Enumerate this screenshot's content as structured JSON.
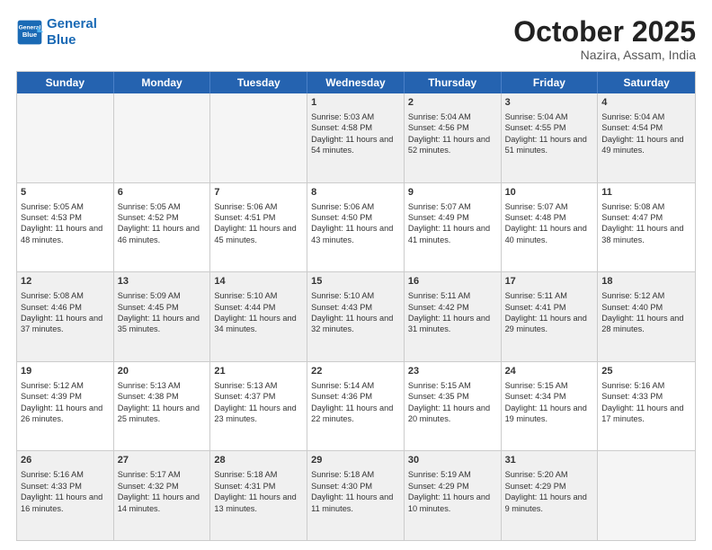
{
  "header": {
    "logo_line1": "General",
    "logo_line2": "Blue",
    "month": "October 2025",
    "location": "Nazira, Assam, India"
  },
  "weekdays": [
    "Sunday",
    "Monday",
    "Tuesday",
    "Wednesday",
    "Thursday",
    "Friday",
    "Saturday"
  ],
  "rows": [
    [
      {
        "day": "",
        "sunrise": "",
        "sunset": "",
        "daylight": "",
        "empty": true
      },
      {
        "day": "",
        "sunrise": "",
        "sunset": "",
        "daylight": "",
        "empty": true
      },
      {
        "day": "",
        "sunrise": "",
        "sunset": "",
        "daylight": "",
        "empty": true
      },
      {
        "day": "1",
        "sunrise": "Sunrise: 5:03 AM",
        "sunset": "Sunset: 4:58 PM",
        "daylight": "Daylight: 11 hours and 54 minutes."
      },
      {
        "day": "2",
        "sunrise": "Sunrise: 5:04 AM",
        "sunset": "Sunset: 4:56 PM",
        "daylight": "Daylight: 11 hours and 52 minutes."
      },
      {
        "day": "3",
        "sunrise": "Sunrise: 5:04 AM",
        "sunset": "Sunset: 4:55 PM",
        "daylight": "Daylight: 11 hours and 51 minutes."
      },
      {
        "day": "4",
        "sunrise": "Sunrise: 5:04 AM",
        "sunset": "Sunset: 4:54 PM",
        "daylight": "Daylight: 11 hours and 49 minutes."
      }
    ],
    [
      {
        "day": "5",
        "sunrise": "Sunrise: 5:05 AM",
        "sunset": "Sunset: 4:53 PM",
        "daylight": "Daylight: 11 hours and 48 minutes."
      },
      {
        "day": "6",
        "sunrise": "Sunrise: 5:05 AM",
        "sunset": "Sunset: 4:52 PM",
        "daylight": "Daylight: 11 hours and 46 minutes."
      },
      {
        "day": "7",
        "sunrise": "Sunrise: 5:06 AM",
        "sunset": "Sunset: 4:51 PM",
        "daylight": "Daylight: 11 hours and 45 minutes."
      },
      {
        "day": "8",
        "sunrise": "Sunrise: 5:06 AM",
        "sunset": "Sunset: 4:50 PM",
        "daylight": "Daylight: 11 hours and 43 minutes."
      },
      {
        "day": "9",
        "sunrise": "Sunrise: 5:07 AM",
        "sunset": "Sunset: 4:49 PM",
        "daylight": "Daylight: 11 hours and 41 minutes."
      },
      {
        "day": "10",
        "sunrise": "Sunrise: 5:07 AM",
        "sunset": "Sunset: 4:48 PM",
        "daylight": "Daylight: 11 hours and 40 minutes."
      },
      {
        "day": "11",
        "sunrise": "Sunrise: 5:08 AM",
        "sunset": "Sunset: 4:47 PM",
        "daylight": "Daylight: 11 hours and 38 minutes."
      }
    ],
    [
      {
        "day": "12",
        "sunrise": "Sunrise: 5:08 AM",
        "sunset": "Sunset: 4:46 PM",
        "daylight": "Daylight: 11 hours and 37 minutes."
      },
      {
        "day": "13",
        "sunrise": "Sunrise: 5:09 AM",
        "sunset": "Sunset: 4:45 PM",
        "daylight": "Daylight: 11 hours and 35 minutes."
      },
      {
        "day": "14",
        "sunrise": "Sunrise: 5:10 AM",
        "sunset": "Sunset: 4:44 PM",
        "daylight": "Daylight: 11 hours and 34 minutes."
      },
      {
        "day": "15",
        "sunrise": "Sunrise: 5:10 AM",
        "sunset": "Sunset: 4:43 PM",
        "daylight": "Daylight: 11 hours and 32 minutes."
      },
      {
        "day": "16",
        "sunrise": "Sunrise: 5:11 AM",
        "sunset": "Sunset: 4:42 PM",
        "daylight": "Daylight: 11 hours and 31 minutes."
      },
      {
        "day": "17",
        "sunrise": "Sunrise: 5:11 AM",
        "sunset": "Sunset: 4:41 PM",
        "daylight": "Daylight: 11 hours and 29 minutes."
      },
      {
        "day": "18",
        "sunrise": "Sunrise: 5:12 AM",
        "sunset": "Sunset: 4:40 PM",
        "daylight": "Daylight: 11 hours and 28 minutes."
      }
    ],
    [
      {
        "day": "19",
        "sunrise": "Sunrise: 5:12 AM",
        "sunset": "Sunset: 4:39 PM",
        "daylight": "Daylight: 11 hours and 26 minutes."
      },
      {
        "day": "20",
        "sunrise": "Sunrise: 5:13 AM",
        "sunset": "Sunset: 4:38 PM",
        "daylight": "Daylight: 11 hours and 25 minutes."
      },
      {
        "day": "21",
        "sunrise": "Sunrise: 5:13 AM",
        "sunset": "Sunset: 4:37 PM",
        "daylight": "Daylight: 11 hours and 23 minutes."
      },
      {
        "day": "22",
        "sunrise": "Sunrise: 5:14 AM",
        "sunset": "Sunset: 4:36 PM",
        "daylight": "Daylight: 11 hours and 22 minutes."
      },
      {
        "day": "23",
        "sunrise": "Sunrise: 5:15 AM",
        "sunset": "Sunset: 4:35 PM",
        "daylight": "Daylight: 11 hours and 20 minutes."
      },
      {
        "day": "24",
        "sunrise": "Sunrise: 5:15 AM",
        "sunset": "Sunset: 4:34 PM",
        "daylight": "Daylight: 11 hours and 19 minutes."
      },
      {
        "day": "25",
        "sunrise": "Sunrise: 5:16 AM",
        "sunset": "Sunset: 4:33 PM",
        "daylight": "Daylight: 11 hours and 17 minutes."
      }
    ],
    [
      {
        "day": "26",
        "sunrise": "Sunrise: 5:16 AM",
        "sunset": "Sunset: 4:33 PM",
        "daylight": "Daylight: 11 hours and 16 minutes."
      },
      {
        "day": "27",
        "sunrise": "Sunrise: 5:17 AM",
        "sunset": "Sunset: 4:32 PM",
        "daylight": "Daylight: 11 hours and 14 minutes."
      },
      {
        "day": "28",
        "sunrise": "Sunrise: 5:18 AM",
        "sunset": "Sunset: 4:31 PM",
        "daylight": "Daylight: 11 hours and 13 minutes."
      },
      {
        "day": "29",
        "sunrise": "Sunrise: 5:18 AM",
        "sunset": "Sunset: 4:30 PM",
        "daylight": "Daylight: 11 hours and 11 minutes."
      },
      {
        "day": "30",
        "sunrise": "Sunrise: 5:19 AM",
        "sunset": "Sunset: 4:29 PM",
        "daylight": "Daylight: 11 hours and 10 minutes."
      },
      {
        "day": "31",
        "sunrise": "Sunrise: 5:20 AM",
        "sunset": "Sunset: 4:29 PM",
        "daylight": "Daylight: 11 hours and 9 minutes."
      },
      {
        "day": "",
        "sunrise": "",
        "sunset": "",
        "daylight": "",
        "empty": true
      }
    ]
  ]
}
